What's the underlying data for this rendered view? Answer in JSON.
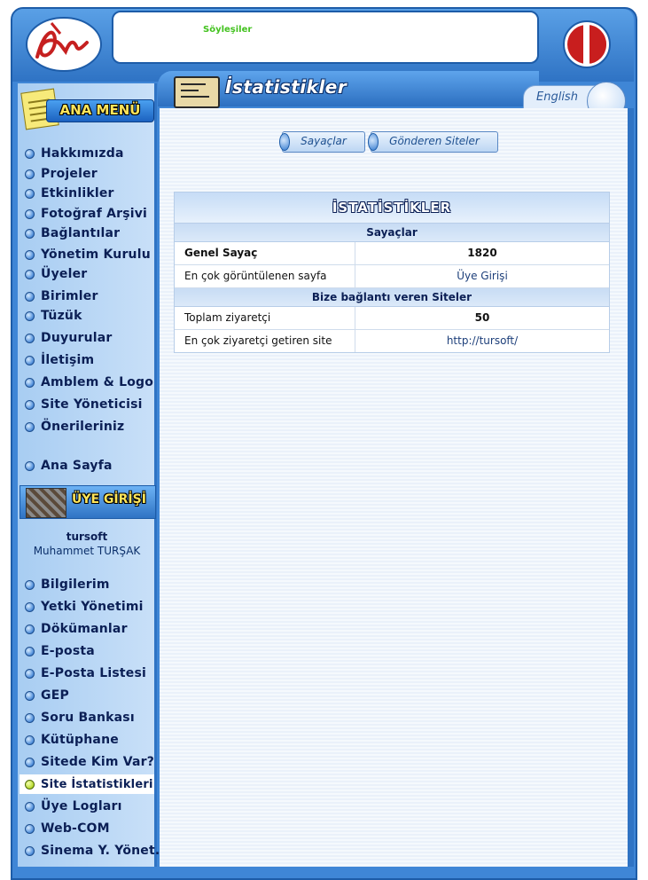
{
  "header": {
    "ticker_text": "Söyleşiler"
  },
  "left_menu": {
    "title": "ANA MENÜ",
    "items": [
      {
        "label": "Hakkımızda",
        "name": "nav-hakkimizda"
      },
      {
        "label": "Projeler",
        "name": "nav-projeler"
      },
      {
        "label": "Etkinlikler",
        "name": "nav-etkinlikler"
      },
      {
        "label": "Fotoğraf Arşivi",
        "name": "nav-fotograf-arsivi"
      },
      {
        "label": "Bağlantılar",
        "name": "nav-baglantilar"
      },
      {
        "label": "Yönetim Kurulu",
        "name": "nav-yonetim-kurulu"
      },
      {
        "label": "Üyeler",
        "name": "nav-uyeler"
      },
      {
        "label": "Birimler",
        "name": "nav-birimler"
      },
      {
        "label": "Tüzük",
        "name": "nav-tuzuk"
      },
      {
        "label": "Duyurular",
        "name": "nav-duyurular"
      },
      {
        "label": "İletişim",
        "name": "nav-iletisim"
      },
      {
        "label": "Amblem & Logo",
        "name": "nav-amblem-logo"
      },
      {
        "label": "Site Yöneticisi",
        "name": "nav-site-yoneticisi"
      },
      {
        "label": "Önerileriniz",
        "name": "nav-onerileriniz"
      },
      {
        "label": "Ana Sayfa",
        "name": "nav-ana-sayfa"
      }
    ]
  },
  "member": {
    "title": "ÜYE GİRİŞİ",
    "login": "tursoft",
    "full_name": "Muhammet TURŞAK",
    "items": [
      {
        "label": "Bilgilerim",
        "name": "nav-bilgilerim"
      },
      {
        "label": "Yetki Yönetimi",
        "name": "nav-yetki-yonetimi"
      },
      {
        "label": "Dökümanlar",
        "name": "nav-dokumanlar"
      },
      {
        "label": "E-posta",
        "name": "nav-e-posta"
      },
      {
        "label": "E-Posta Listesi",
        "name": "nav-e-posta-listesi"
      },
      {
        "label": "GEP",
        "name": "nav-gep"
      },
      {
        "label": "Soru Bankası",
        "name": "nav-soru-bankasi"
      },
      {
        "label": "Kütüphane",
        "name": "nav-kutuphane"
      },
      {
        "label": "Sitede Kim Var?",
        "name": "nav-sitede-kim-var"
      },
      {
        "label": "Site İstatistikleri",
        "name": "nav-site-istatistikleri",
        "active": true
      },
      {
        "label": "Üye Logları",
        "name": "nav-uye-loglari"
      },
      {
        "label": "Web-COM",
        "name": "nav-web-com"
      },
      {
        "label": "Sinema Y. Yönet.",
        "name": "nav-sinema-y-yonet"
      }
    ]
  },
  "page": {
    "title": "İstatistikler",
    "language_link": "English",
    "tabs": [
      {
        "label": "Sayaçlar"
      },
      {
        "label": "Gönderen Siteler"
      }
    ]
  },
  "stats": {
    "heading": "İSTATİSTİKLER",
    "sections": [
      {
        "title": "Sayaçlar",
        "rows": [
          {
            "key": "Genel Sayaç",
            "value": "1820",
            "bold_key": true,
            "numeric": true
          },
          {
            "key": "En çok görüntülenen sayfa",
            "value": "Üye Girişi",
            "bold_key": false,
            "numeric": false
          }
        ]
      },
      {
        "title": "Bize bağlantı veren Siteler",
        "rows": [
          {
            "key": "Toplam ziyaretçi",
            "value": "50",
            "bold_key": false,
            "numeric": true
          },
          {
            "key": "En çok ziyaretçi getiren site",
            "value": "http://tursoft/",
            "bold_key": false,
            "numeric": false
          }
        ]
      }
    ]
  },
  "colors": {
    "frame_blue": "#3f86d6",
    "menu_text": "#0b1f55",
    "ticker_green": "#43c21f",
    "badge_yellow": "#ffe55a",
    "active_dot": "#b5d82a"
  }
}
